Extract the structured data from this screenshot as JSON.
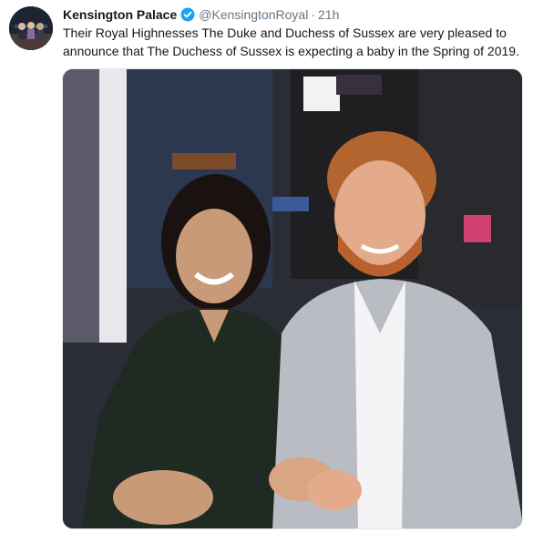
{
  "tweet": {
    "author_name": "Kensington Palace",
    "handle": "@KensingtonRoyal",
    "separator": "·",
    "time": "21h",
    "text_line1": "Their Royal Highnesses The Duke and Duchess of Sussex are very pleased to",
    "text_line2": "announce that The Duchess of Sussex is expecting a baby in the Spring of 2019."
  },
  "icons": {
    "verified": "verified-badge-icon"
  },
  "colors": {
    "verified_blue": "#1da1f2",
    "secondary_text": "#657786",
    "primary_text": "#14171a"
  }
}
